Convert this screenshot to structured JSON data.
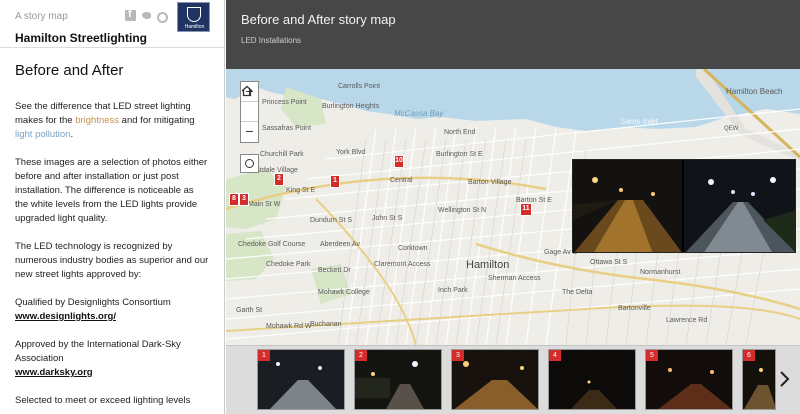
{
  "side": {
    "tagline": "A story map",
    "logo_text": "Hamilton",
    "site_title": "Hamilton Streetlighting",
    "heading": "Before and After",
    "p1_a": "See the difference that LED street lighting makes for the ",
    "p1_brightness": "brightness",
    "p1_b": " and for mitigating ",
    "p1_pollution": "light pollution",
    "p1_c": ".",
    "p2": "These images are a selection of photos either before and after installation or just post installation. The difference is noticeable as the white levels from the LED lights provide upgraded light quality.",
    "p3": "The LED technology is recognized by numerous industry bodies as superior and our new street lights approved by:",
    "p4_text": "Qualified by Designlights Consortium",
    "p4_link": "www.designlights.org/",
    "p5_text": "Approved by the International Dark-Sky Association",
    "p5_link": "www.darksky.org",
    "p6": "Selected to meet or exceed lighting levels"
  },
  "header": {
    "title": "Before and After story map",
    "subtitle": "LED Installations"
  },
  "map": {
    "zoom_in": "+",
    "zoom_out": "−",
    "labels": {
      "hamilton": "Hamilton",
      "hamilton_beach": "Hamilton Beach",
      "mccassa_bay": "McCassa Bay",
      "sams_inlet": "Sams Inlet",
      "carrolls_point": "Carrolls Point",
      "burlington_heights": "Burlington Heights",
      "princess_point": "Princess Point",
      "sassafras_point": "Sassafras Point",
      "churchill_park": "Churchill Park",
      "westdale_village": "Westdale Village",
      "chedoke_golf": "Chedoke Golf Course",
      "chedoke_park": "Chedoke Park",
      "mohawk_college": "Mohawk College",
      "buchanan": "Buchanan",
      "central": "Central",
      "north_end": "North End",
      "barton_village": "Barton Village",
      "corktown": "Corktown",
      "inch_park": "Inch Park",
      "the_delta": "The Delta",
      "bartonville": "Bartonville",
      "normanhurst": "Normanhurst",
      "qew": "QEW",
      "burlington_st": "Burlington St E",
      "main_st": "Main St W",
      "barton_st": "Barton St E",
      "king_st": "King St E",
      "sherman_access": "Sherman Access",
      "aberdeen": "Aberdeen Av",
      "claremont": "Claremont Access",
      "mohawk_rd": "Mohawk Rd W",
      "beckett": "Beckett Dr",
      "dundurn": "Dundurn St S",
      "john_st": "John St S",
      "york_blvd": "York Blvd",
      "wellington": "Wellington St N",
      "gage": "Gage Av S",
      "ottawa": "Ottawa St S",
      "lawrence": "Lawrence Rd",
      "garth": "Garth St"
    },
    "markers": [
      "1",
      "2",
      "3",
      "10",
      "8",
      "11"
    ]
  },
  "carousel": {
    "thumbs": [
      "1",
      "2",
      "3",
      "4",
      "5",
      "6"
    ]
  }
}
